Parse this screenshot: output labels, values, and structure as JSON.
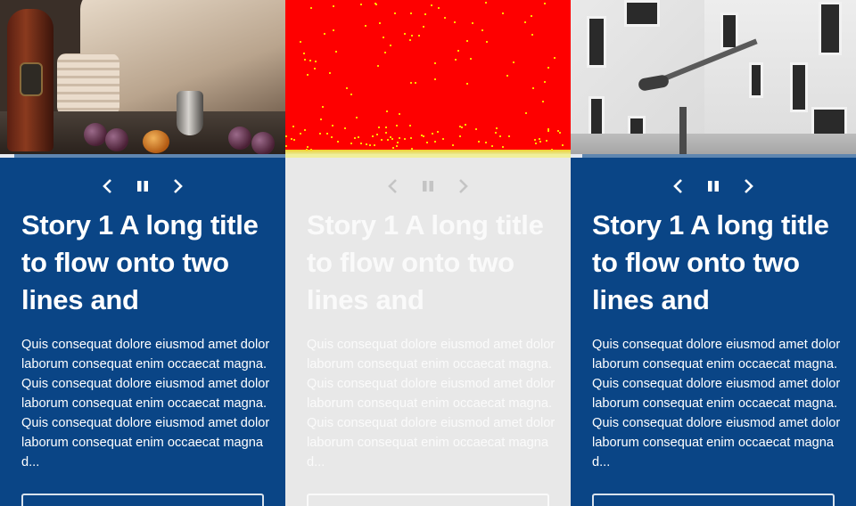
{
  "cards": [
    {
      "theme": "blue",
      "image": "still-life-photo",
      "progress": 0.05,
      "title": "Story 1 A long title to flow onto two lines and",
      "body": "Quis consequat dolore eiusmod amet dolor laborum consequat enim occaecat magna. Quis consequat dolore eiusmod amet dolor laborum consequat enim occaecat magna. Quis consequat dolore eiusmod amet dolor laborum consequat enim occaecat magna d...",
      "controls": [
        "chevron-left-icon",
        "pause-icon",
        "chevron-right-icon"
      ]
    },
    {
      "theme": "grey",
      "image": "red-photo",
      "progress": 1.0,
      "title": "Story 1 A long title to flow onto two lines and",
      "body": "Quis consequat dolore eiusmod amet dolor laborum consequat enim occaecat magna. Quis consequat dolore eiusmod amet dolor laborum consequat enim occaecat magna. Quis consequat dolore eiusmod amet dolor laborum consequat enim occaecat magna d...",
      "controls": [
        "chevron-left-icon",
        "pause-icon",
        "chevron-right-icon"
      ]
    },
    {
      "theme": "blue",
      "image": "building-photo",
      "progress": 0.04,
      "title": "Story 1 A long title to flow onto two lines and",
      "body": "Quis consequat dolore eiusmod amet dolor laborum consequat enim occaecat magna. Quis consequat dolore eiusmod amet dolor laborum consequat enim occaecat magna. Quis consequat dolore eiusmod amet dolor laborum consequat enim occaecat magna d...",
      "controls": [
        "chevron-left-icon",
        "pause-icon",
        "chevron-right-icon"
      ]
    }
  ],
  "colors": {
    "card_blue": "#0a4586",
    "card_grey": "#e8e8e8",
    "image_red": "#fe0000"
  }
}
